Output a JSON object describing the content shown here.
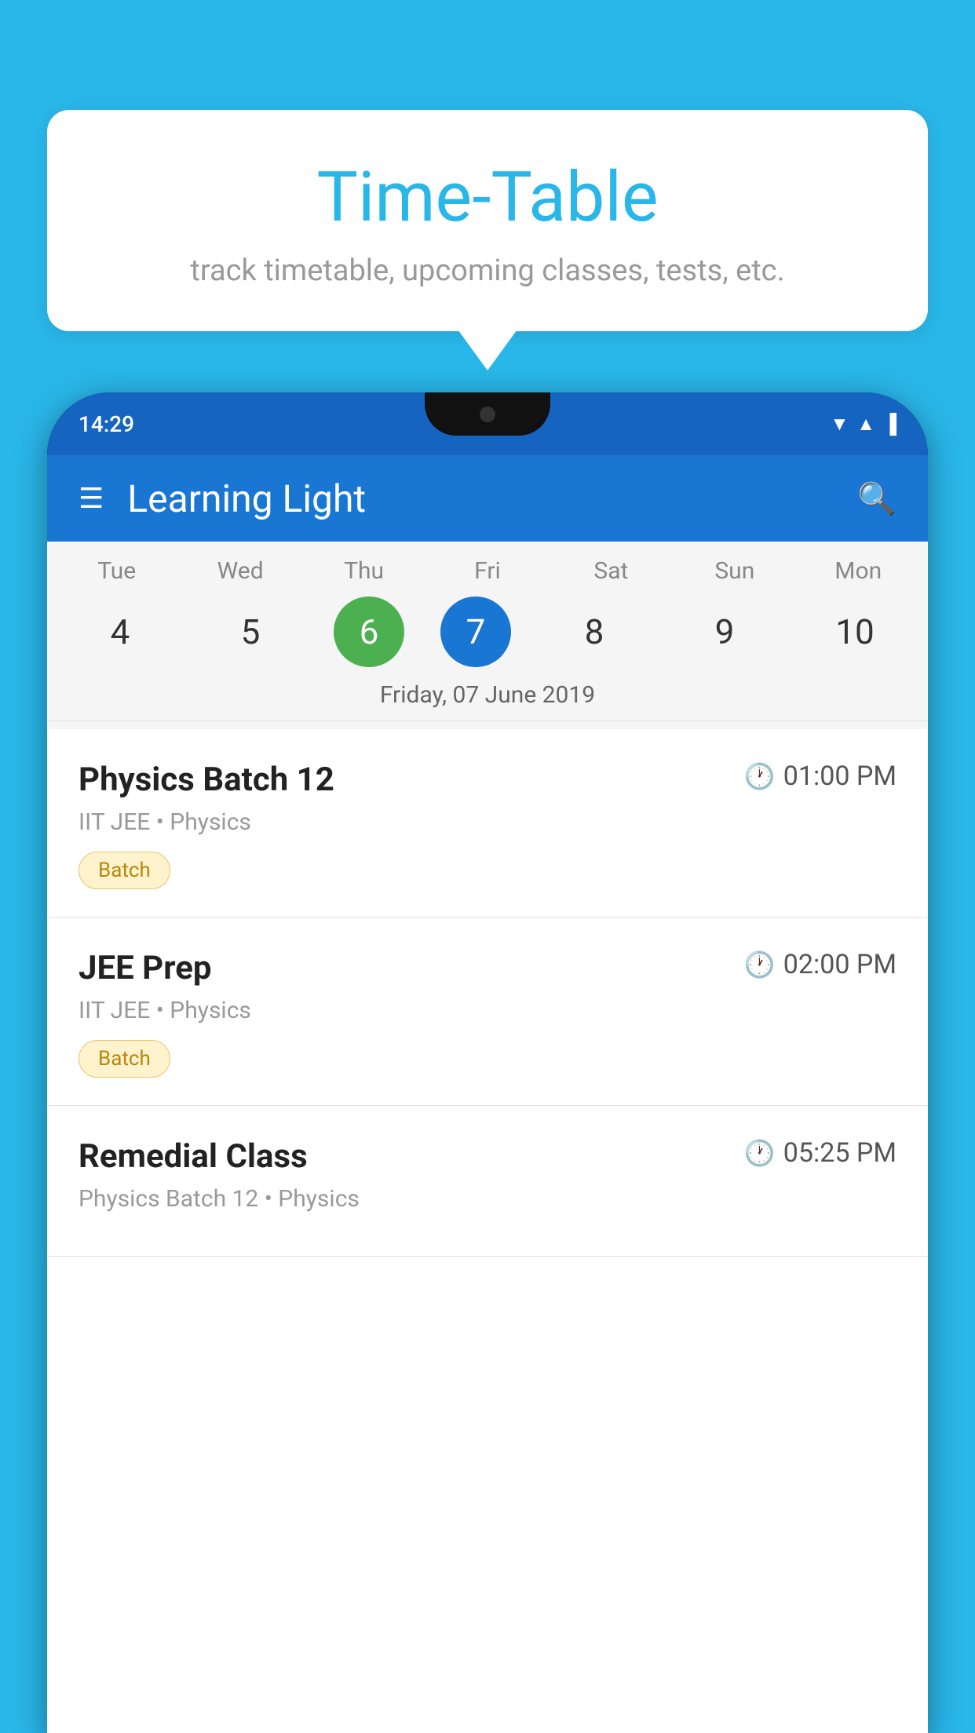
{
  "background_color": "#29b6e8",
  "bubble": {
    "title": "Time-Table",
    "subtitle": "track timetable, upcoming classes, tests, etc."
  },
  "phone": {
    "status_bar": {
      "time": "14:29"
    },
    "app_bar": {
      "title": "Learning Light"
    },
    "calendar": {
      "days": [
        "Tue",
        "Wed",
        "Thu",
        "Fri",
        "Sat",
        "Sun",
        "Mon"
      ],
      "dates": [
        "4",
        "5",
        "6",
        "7",
        "8",
        "9",
        "10"
      ],
      "today_index": 2,
      "selected_index": 3,
      "selected_label": "Friday, 07 June 2019"
    },
    "schedule": [
      {
        "title": "Physics Batch 12",
        "time": "01:00 PM",
        "subtitle": "IIT JEE • Physics",
        "tag": "Batch"
      },
      {
        "title": "JEE Prep",
        "time": "02:00 PM",
        "subtitle": "IIT JEE • Physics",
        "tag": "Batch"
      },
      {
        "title": "Remedial Class",
        "time": "05:25 PM",
        "subtitle": "Physics Batch 12 • Physics",
        "tag": null
      }
    ]
  }
}
